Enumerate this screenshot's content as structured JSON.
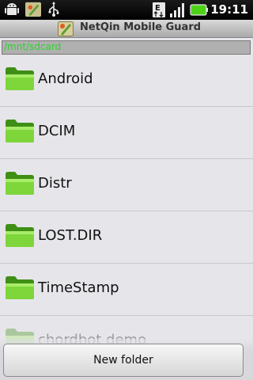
{
  "status_bar": {
    "icons": [
      "android-icon",
      "netqin-notification-icon",
      "usb-icon",
      "edge-data-icon",
      "signal-icon",
      "battery-icon"
    ],
    "time": "19:11"
  },
  "title_bar": {
    "title": "NetQin Mobile Guard",
    "icon": "netqin-app-icon"
  },
  "path": "/mnt/sdcard",
  "files": [
    {
      "name": "Android",
      "icon": "folder-icon"
    },
    {
      "name": "DCIM",
      "icon": "folder-icon"
    },
    {
      "name": "Distr",
      "icon": "folder-icon"
    },
    {
      "name": "LOST.DIR",
      "icon": "folder-icon"
    },
    {
      "name": "TimeStamp",
      "icon": "folder-icon"
    },
    {
      "name": "chordbot demo",
      "icon": "folder-icon"
    }
  ],
  "new_folder_label": "New folder",
  "colors": {
    "path_text": "#2cd32c",
    "battery": "#4cd318",
    "folder": "#6fcf2a"
  }
}
